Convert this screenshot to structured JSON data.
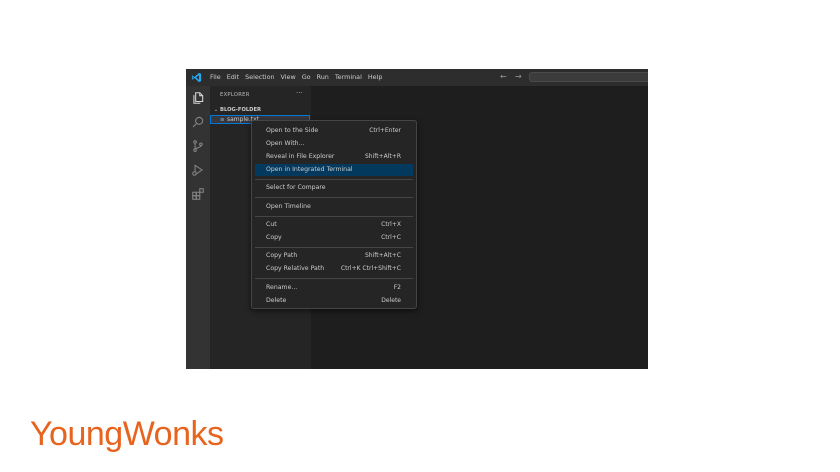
{
  "menubar": {
    "items": [
      "File",
      "Edit",
      "Selection",
      "View",
      "Go",
      "Run",
      "Terminal",
      "Help"
    ]
  },
  "nav": {
    "back": "←",
    "forward": "→"
  },
  "explorer": {
    "title": "EXPLORER",
    "more": "···",
    "folder_chevron": "⌄",
    "folder": "BLOG-FOLDER",
    "file_icon": "≡",
    "file": "sample.txt"
  },
  "context_menu": {
    "items": [
      {
        "label": "Open to the Side",
        "shortcut": "Ctrl+Enter"
      },
      {
        "label": "Open With...",
        "shortcut": ""
      },
      {
        "label": "Reveal in File Explorer",
        "shortcut": "Shift+Alt+R"
      },
      {
        "label": "Open in Integrated Terminal",
        "shortcut": "",
        "active": true
      },
      {
        "label": "Select for Compare",
        "shortcut": ""
      },
      {
        "label": "Open Timeline",
        "shortcut": ""
      },
      {
        "label": "Cut",
        "shortcut": "Ctrl+X"
      },
      {
        "label": "Copy",
        "shortcut": "Ctrl+C"
      },
      {
        "label": "Copy Path",
        "shortcut": "Shift+Alt+C"
      },
      {
        "label": "Copy Relative Path",
        "shortcut": "Ctrl+K Ctrl+Shift+C"
      },
      {
        "label": "Rename...",
        "shortcut": "F2"
      },
      {
        "label": "Delete",
        "shortcut": "Delete"
      }
    ]
  },
  "icons": {
    "activity": [
      "files-icon",
      "search-icon",
      "source-control-icon",
      "run-debug-icon",
      "extensions-icon"
    ]
  },
  "brand": {
    "logo": "YoungWonks"
  },
  "colors": {
    "editor_bg": "#1e1e1e",
    "titlebar_bg": "#2d2d2d",
    "activitybar_bg": "#333333",
    "sidebar_bg": "#252526",
    "menu_highlight": "#04395e",
    "focus_border": "#0078d4",
    "brand_orange": "#e8641e"
  }
}
